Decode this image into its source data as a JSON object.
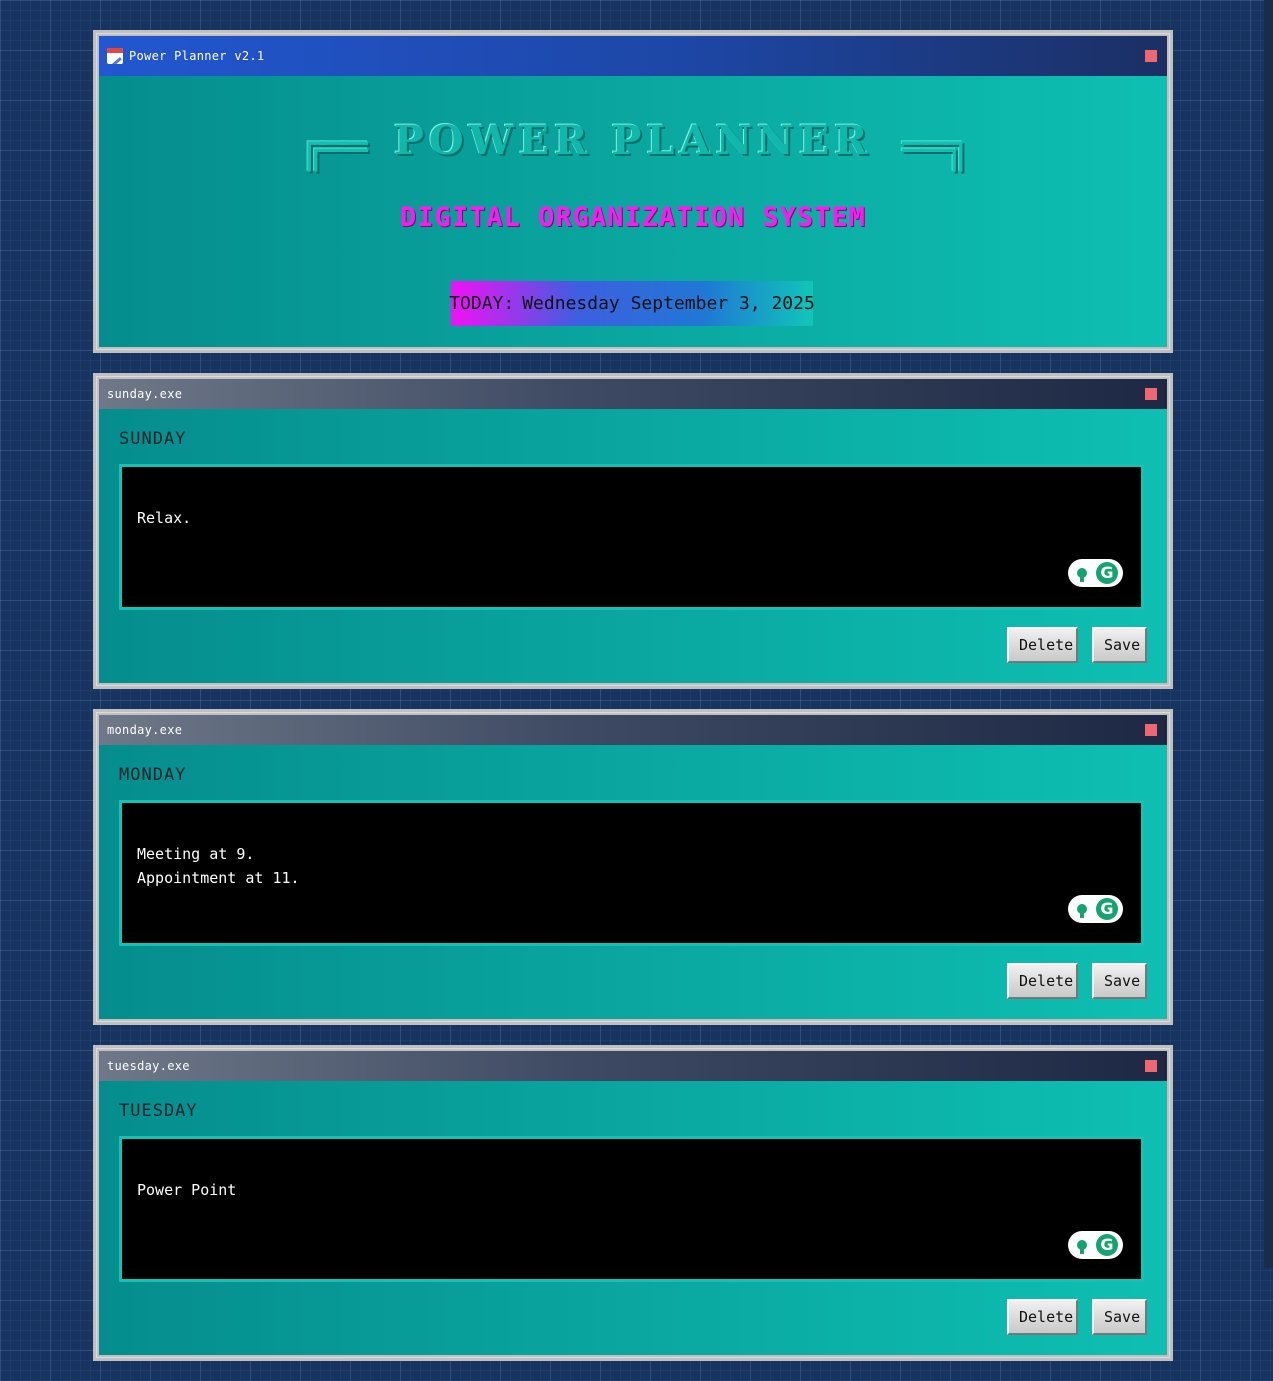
{
  "window": {
    "title": "Power Planner v2.1"
  },
  "header": {
    "logo_left": "╔══",
    "logo_title": "POWER PLANNER",
    "logo_right": "══╗",
    "subtitle": "DIGITAL ORGANIZATION SYSTEM",
    "today_label": "TODAY:",
    "today_value": "Wednesday September 3, 2025"
  },
  "days": [
    {
      "window_title": "sunday.exe",
      "label": "SUNDAY",
      "notes": "Relax.",
      "delete_label": "Delete",
      "save_label": "Save"
    },
    {
      "window_title": "monday.exe",
      "label": "MONDAY",
      "notes": "Meeting at 9.\nAppointment at 11.",
      "delete_label": "Delete",
      "save_label": "Save"
    },
    {
      "window_title": "tuesday.exe",
      "label": "TUESDAY",
      "notes": "Power Point",
      "delete_label": "Delete",
      "save_label": "Save"
    }
  ],
  "grammarly": {
    "g_letter": "G"
  },
  "colors": {
    "accent_teal": "#0aa9a1",
    "subtitle_magenta": "#ff18f0",
    "close_red": "#f0686f",
    "background_navy": "#173461"
  }
}
